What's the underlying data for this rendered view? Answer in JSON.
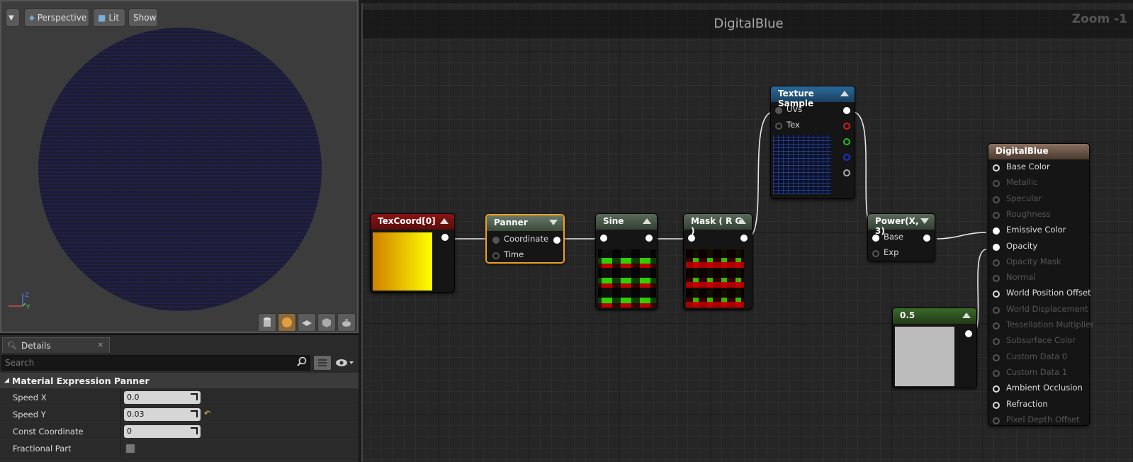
{
  "viewport": {
    "perspective_label": "Perspective",
    "lit_label": "Lit",
    "show_label": "Show",
    "axis_z": "Z",
    "axis_y": "Y"
  },
  "details": {
    "tab_label": "Details",
    "search_placeholder": "Search",
    "section_title": "Material Expression Panner",
    "rows": [
      {
        "label": "Speed X",
        "value": "0.0"
      },
      {
        "label": "Speed Y",
        "value": "0.03"
      },
      {
        "label": "Const Coordinate",
        "value": "0"
      },
      {
        "label": "Fractional Part",
        "value": ""
      }
    ]
  },
  "graph": {
    "title": "DigitalBlue",
    "zoom": "Zoom -1"
  },
  "nodes": {
    "texcoord": {
      "title": "TexCoord[0]"
    },
    "panner": {
      "title": "Panner",
      "pins": [
        "Coordinate",
        "Time"
      ]
    },
    "sine": {
      "title": "Sine"
    },
    "mask": {
      "title": "Mask ( R G )"
    },
    "texsample": {
      "title": "Texture Sample",
      "pins": [
        "UVs",
        "Tex"
      ]
    },
    "power": {
      "title": "Power(X, 3)",
      "pins": [
        "Base",
        "Exp"
      ]
    },
    "const": {
      "title": "0.5"
    },
    "material": {
      "title": "DigitalBlue",
      "pins": [
        {
          "label": "Base Color",
          "active": true
        },
        {
          "label": "Metallic",
          "active": false
        },
        {
          "label": "Specular",
          "active": false
        },
        {
          "label": "Roughness",
          "active": false
        },
        {
          "label": "Emissive Color",
          "active": true
        },
        {
          "label": "Opacity",
          "active": true
        },
        {
          "label": "Opacity Mask",
          "active": false
        },
        {
          "label": "Normal",
          "active": false
        },
        {
          "label": "World Position Offset",
          "active": true
        },
        {
          "label": "World Displacement",
          "active": false
        },
        {
          "label": "Tessellation Multiplier",
          "active": false
        },
        {
          "label": "Subsurface Color",
          "active": false
        },
        {
          "label": "Custom Data 0",
          "active": false
        },
        {
          "label": "Custom Data 1",
          "active": false
        },
        {
          "label": "Ambient Occlusion",
          "active": true
        },
        {
          "label": "Refraction",
          "active": true
        },
        {
          "label": "Pixel Depth Offset",
          "active": false
        }
      ]
    }
  }
}
